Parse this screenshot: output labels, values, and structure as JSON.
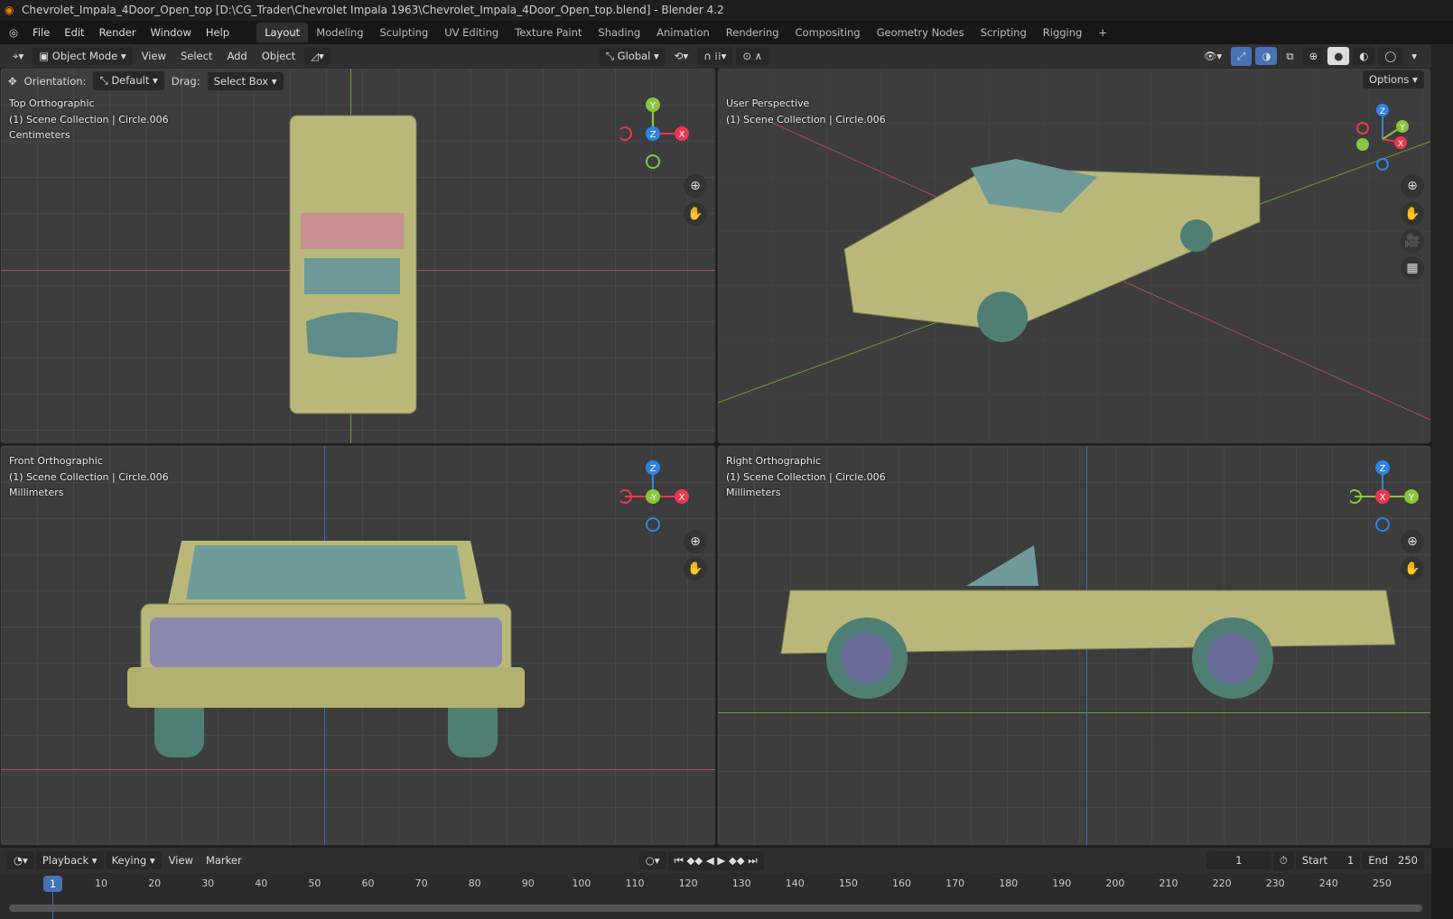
{
  "window_title": "Chevrolet_Impala_4Door_Open_top [D:\\CG_Trader\\Chevrolet Impala 1963\\Chevrolet_Impala_4Door_Open_top.blend] - Blender 4.2",
  "menu": [
    "File",
    "Edit",
    "Render",
    "Window",
    "Help"
  ],
  "workspaces": [
    "Layout",
    "Modeling",
    "Sculpting",
    "UV Editing",
    "Texture Paint",
    "Shading",
    "Animation",
    "Rendering",
    "Compositing",
    "Geometry Nodes",
    "Scripting",
    "Rigging",
    "+"
  ],
  "header": {
    "mode": "Object Mode",
    "menus": [
      "View",
      "Select",
      "Add",
      "Object"
    ],
    "transform_orientation": "Global",
    "options": "Options"
  },
  "tool_settings": {
    "orientation_label": "Orientation:",
    "orientation_value": "Default",
    "drag_label": "Drag:",
    "drag_value": "Select Box"
  },
  "viewports": [
    {
      "name": "Top Orthographic",
      "collection": "(1) Scene Collection | Circle.006",
      "units": "Centimeters"
    },
    {
      "name": "User Perspective",
      "collection": "(1) Scene Collection | Circle.006",
      "units": ""
    },
    {
      "name": "Front Orthographic",
      "collection": "(1) Scene Collection | Circle.006",
      "units": "Millimeters"
    },
    {
      "name": "Right Orthographic",
      "collection": "(1) Scene Collection | Circle.006",
      "units": "Millimeters"
    }
  ],
  "axes": {
    "x": "X",
    "y": "Y",
    "z": "Z",
    "neg_y": "-Y"
  },
  "colors": {
    "x": "#e8384f",
    "y": "#8bc53f",
    "z": "#2f84e3",
    "car": "#b9b87a",
    "glass": "#6f9a9a"
  },
  "timeline": {
    "menus": [
      "Playback",
      "Keying",
      "View",
      "Marker"
    ],
    "current_frame": "1",
    "start_label": "Start",
    "start": "1",
    "end_label": "End",
    "end": "250",
    "ticks": [
      "10",
      "20",
      "30",
      "40",
      "50",
      "60",
      "70",
      "80",
      "90",
      "100",
      "110",
      "120",
      "130",
      "140",
      "150",
      "160",
      "170",
      "180",
      "190",
      "200",
      "210",
      "220",
      "230",
      "240",
      "250"
    ]
  }
}
